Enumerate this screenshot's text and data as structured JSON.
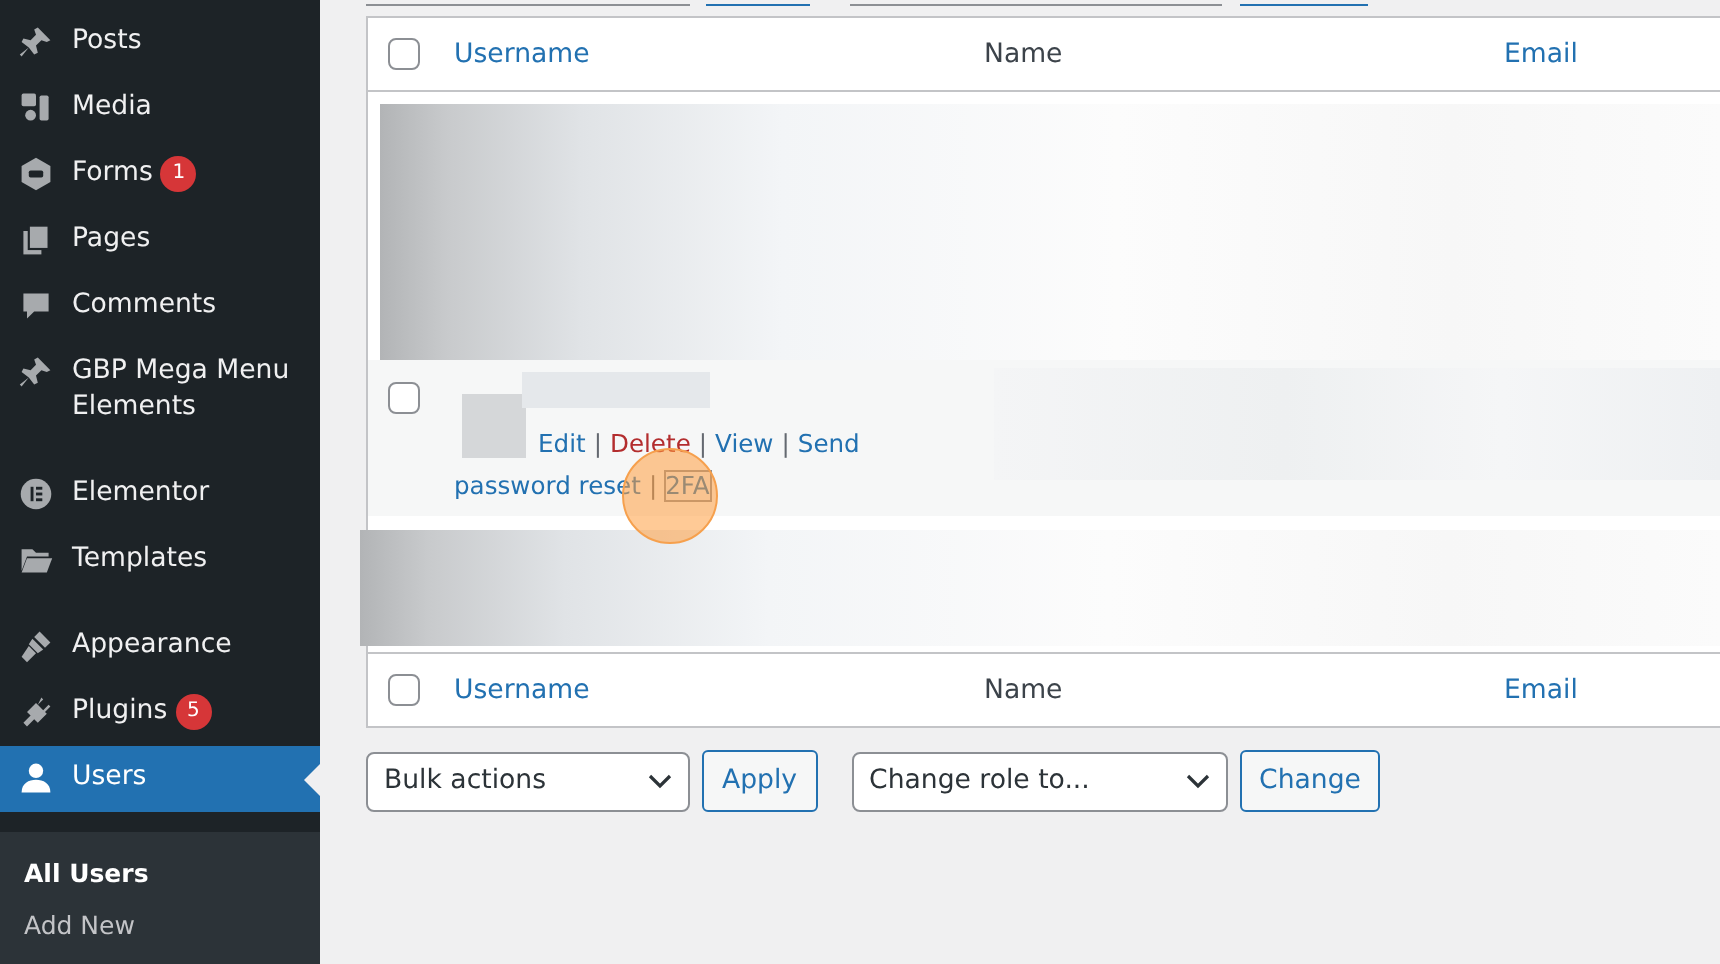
{
  "menu_groups": [
    [
      {
        "kind": "pin",
        "label": "Posts",
        "selected": false
      },
      {
        "kind": "media",
        "label": "Media",
        "selected": false
      },
      {
        "kind": "forms",
        "label": "Forms",
        "badge": "1",
        "selected": false
      },
      {
        "kind": "pages",
        "label": "Pages",
        "selected": false
      },
      {
        "kind": "comments",
        "label": "Comments",
        "selected": false
      },
      {
        "kind": "pin",
        "label": "GBP Mega Menu Elements",
        "selected": false
      }
    ],
    [
      {
        "kind": "elementor",
        "label": "Elementor",
        "selected": false
      },
      {
        "kind": "folder",
        "label": "Templates",
        "selected": false
      }
    ],
    [
      {
        "kind": "brush",
        "label": "Appearance",
        "selected": false
      },
      {
        "kind": "plug",
        "label": "Plugins",
        "badge": "5",
        "selected": false
      },
      {
        "kind": "user",
        "label": "Users",
        "selected": true
      }
    ]
  ],
  "submenu": [
    {
      "label": "All Users",
      "selected": true
    },
    {
      "label": "Add New",
      "selected": false
    }
  ],
  "table": {
    "columns": [
      {
        "label": "Username",
        "link": true
      },
      {
        "label": "Name",
        "link": false
      },
      {
        "label": "Email",
        "link": true
      }
    ],
    "footer_columns": [
      {
        "label": "Username",
        "link": true
      },
      {
        "label": "Name",
        "link": false
      },
      {
        "label": "Email",
        "link": true
      }
    ],
    "select_all_checked": false,
    "rows": [
      {
        "kind": "blurred"
      },
      {
        "kind": "user",
        "checked": false,
        "separator": "|",
        "actions": [
          {
            "label": "Edit",
            "kind": "normal",
            "focused": false
          },
          {
            "label": "Delete",
            "kind": "delete",
            "focused": false
          },
          {
            "label": "View",
            "kind": "normal",
            "focused": false
          },
          {
            "label": "Send",
            "kind": "normal",
            "focused": false
          },
          {
            "label": "password reset",
            "kind": "normal",
            "joined": true,
            "focused": false
          },
          {
            "label": "2FA",
            "kind": "normal",
            "focused": true
          }
        ]
      },
      {
        "kind": "blurred"
      }
    ]
  },
  "bulk": {
    "actions": {
      "value": "Bulk actions",
      "button": "Apply"
    },
    "role": {
      "value": "Change role to...",
      "button": "Change"
    }
  }
}
